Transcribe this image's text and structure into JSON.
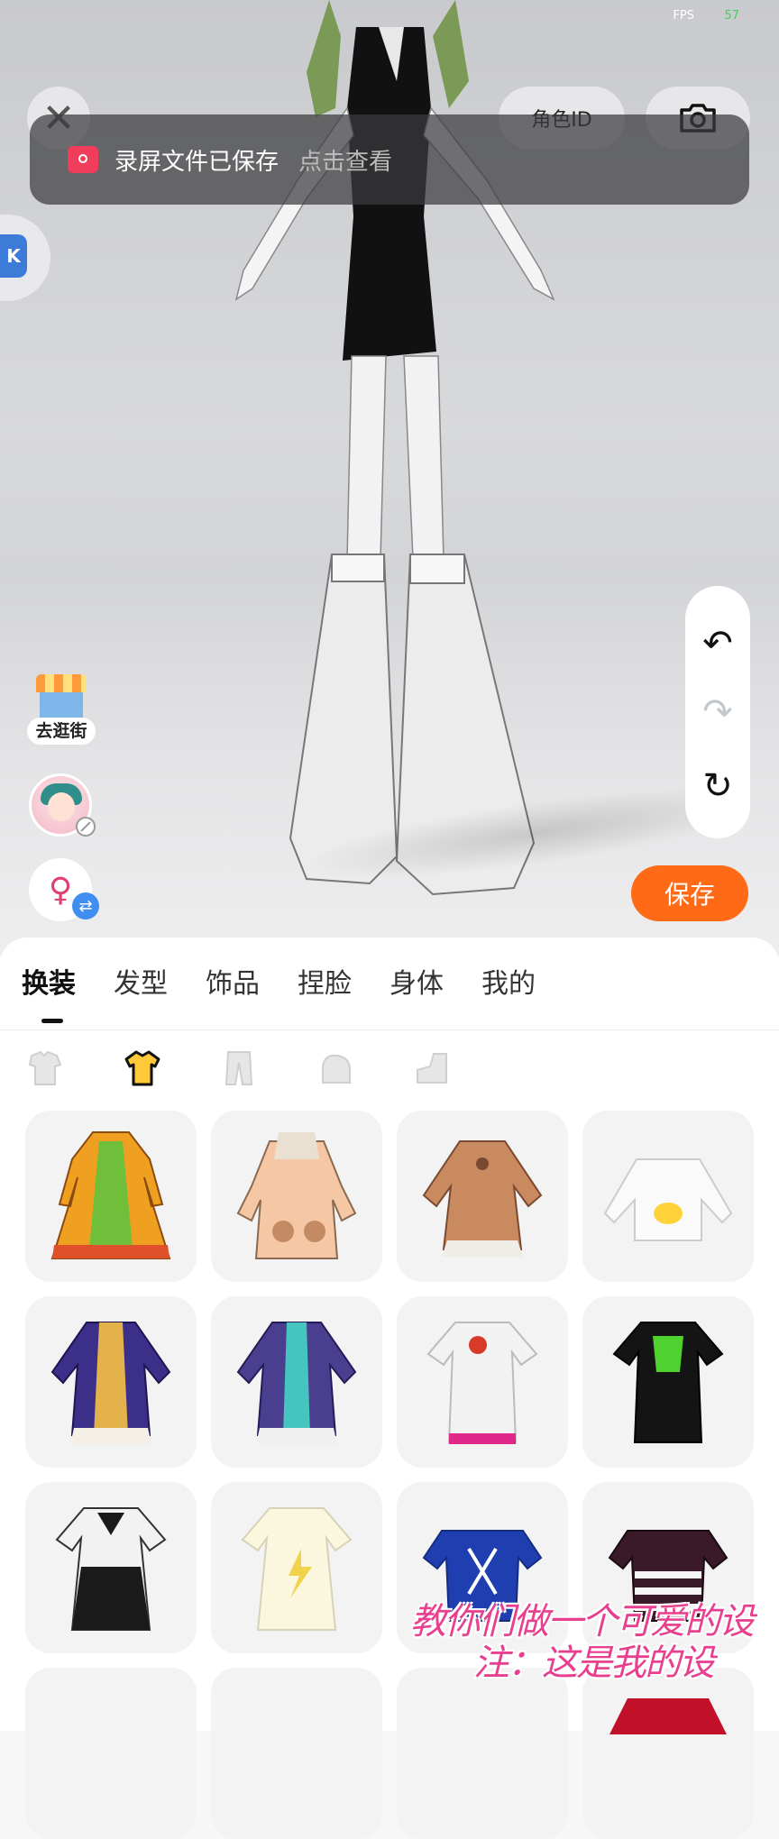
{
  "status": {
    "fps_label": "FPS",
    "fps_value": "57"
  },
  "top": {
    "role_id_label": "角色ID"
  },
  "toast": {
    "message": "录屏文件已保存",
    "action": "点击查看"
  },
  "side": {
    "shop_label": "去逛街"
  },
  "actions": {
    "save_label": "保存"
  },
  "tabs": [
    {
      "label": "换装",
      "active": true
    },
    {
      "label": "发型",
      "active": false
    },
    {
      "label": "饰品",
      "active": false
    },
    {
      "label": "捏脸",
      "active": false
    },
    {
      "label": "身体",
      "active": false
    },
    {
      "label": "我的",
      "active": false
    }
  ],
  "subcategories": [
    {
      "icon": "outfit-set-icon",
      "active": false
    },
    {
      "icon": "top-shirt-icon",
      "active": true
    },
    {
      "icon": "pants-icon",
      "active": false
    },
    {
      "icon": "gloves-icon",
      "active": false
    },
    {
      "icon": "shoes-icon",
      "active": false
    }
  ],
  "clothing_items": [
    {
      "name": "orange-green-robe",
      "colors": [
        "#f0a020",
        "#6fbf3a",
        "#e0502a"
      ]
    },
    {
      "name": "peach-bear-coat",
      "colors": [
        "#f5c7a5",
        "#e9e0d2",
        "#8a6a50"
      ]
    },
    {
      "name": "brown-cape-dress",
      "colors": [
        "#c98a60",
        "#f0ece6",
        "#7a4a30"
      ]
    },
    {
      "name": "white-duck-sweater",
      "colors": [
        "#fafafa",
        "#ffd23a",
        "#dddddd"
      ]
    },
    {
      "name": "purple-gold-robe",
      "colors": [
        "#3c2f8a",
        "#e3b24a",
        "#f4f0e8"
      ]
    },
    {
      "name": "purple-teal-robe",
      "colors": [
        "#4a3f8e",
        "#45c4c0",
        "#f0f0f0"
      ]
    },
    {
      "name": "white-pink-tee-dress",
      "colors": [
        "#f2f2f2",
        "#e0288a",
        "#d83a2a"
      ]
    },
    {
      "name": "black-green-tee-dress",
      "colors": [
        "#141414",
        "#4fd12f",
        "#ffffff"
      ]
    },
    {
      "name": "black-white-star-dress",
      "colors": [
        "#1a1a1a",
        "#f2f2f2",
        "#888888"
      ]
    },
    {
      "name": "cream-lightning-dress",
      "colors": [
        "#fbf6de",
        "#f2d24a",
        "#e9e4cc"
      ]
    },
    {
      "name": "blue-laced-top",
      "colors": [
        "#1f3fb0",
        "#ffffff",
        "#152c80"
      ]
    },
    {
      "name": "striped-crop-top",
      "colors": [
        "#3a1a28",
        "#f4f4f4",
        "#2a2a2a"
      ]
    }
  ],
  "overlay": {
    "line1": "教你们做一个可爱的设",
    "line2": "注：这是我的设"
  }
}
